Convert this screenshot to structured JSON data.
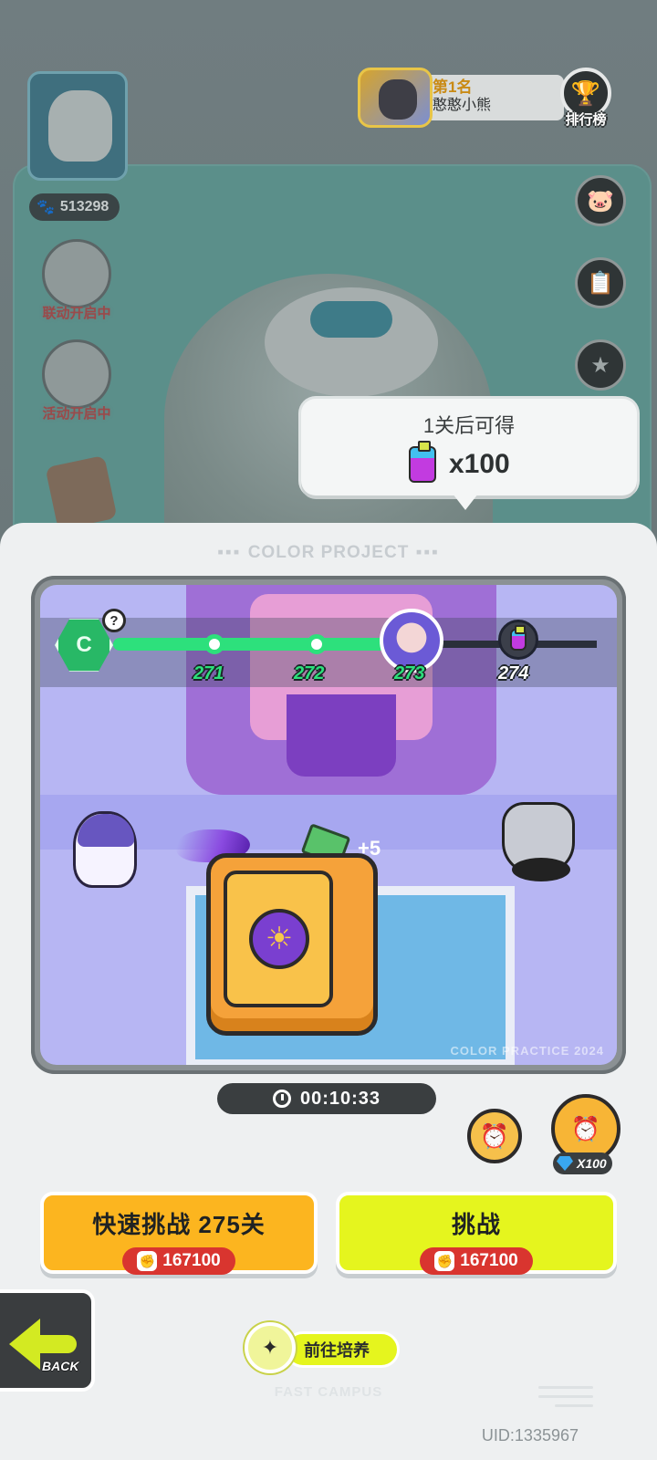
{
  "scene": {
    "paw_count": "513298",
    "events": [
      {
        "label": "联动开启中"
      },
      {
        "label": "活动开启中"
      }
    ]
  },
  "ranking": {
    "place": "第1名",
    "player_name": "憨憨小熊",
    "button_label": "排行榜"
  },
  "tooltip": {
    "title": "1关后可得",
    "reward_icon": "spray-can-icon",
    "reward_qty": "x100"
  },
  "sheet": {
    "header": "COLOR PROJECT",
    "map": {
      "levels": [
        {
          "num": "271",
          "state": "cleared"
        },
        {
          "num": "272",
          "state": "cleared"
        },
        {
          "num": "273",
          "state": "current"
        },
        {
          "num": "274",
          "state": "reward"
        }
      ],
      "help_badge": "?",
      "pickup_text": "+5",
      "watermark": "COLOR PRACTICE 2024"
    },
    "timer": "00:10:33",
    "gem_cost": "X100",
    "quick_challenge": {
      "label": "快速挑战 275关",
      "cost": "167100"
    },
    "challenge": {
      "label": "挑战",
      "cost": "167100"
    },
    "back_label": "BACK",
    "train_label": "前往培养",
    "footer_mark": "FAST CAMPUS",
    "uid": "UID:1335967"
  },
  "colors": {
    "accent_yellow": "#fcb51f",
    "accent_lime": "#e5f51e",
    "cost_red": "#d9352f",
    "progress_green": "#2de07c"
  }
}
